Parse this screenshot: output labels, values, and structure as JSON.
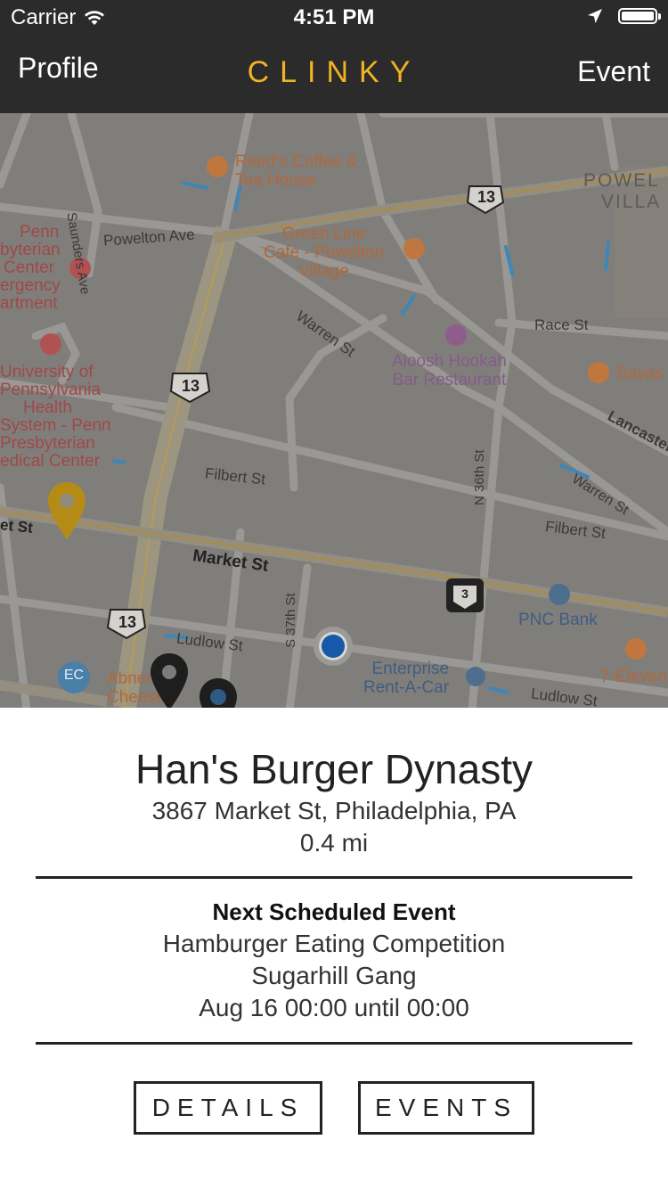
{
  "status_bar": {
    "carrier": "Carrier",
    "time": "4:51 PM",
    "icons": [
      "wifi-icon",
      "location-arrow-icon",
      "battery-icon"
    ]
  },
  "nav": {
    "left_label": "Profile",
    "title": "CLINKY",
    "right_label": "Event",
    "title_color": "#f0b323",
    "bar_color": "#2b2b2b"
  },
  "map": {
    "streets": [
      "Powelton Ave",
      "Warren St",
      "Race St",
      "Lancaster",
      "Filbert St",
      "Market St",
      "Ludlow St",
      "N 36th St",
      "S 37th St",
      "Saunders Ave",
      "Warren St",
      "Filbert St",
      "Ludlow St",
      "et St"
    ],
    "route_shields": [
      "13",
      "13",
      "13",
      "3"
    ],
    "places": [
      "Reed's Coffee &",
      "Tea House",
      "Green Line",
      "Cafe - Powelton",
      "Village",
      "Aloosh Hookah",
      "Bar Restaurant",
      "Savas",
      "PNC Bank",
      "7-Eleven",
      "Enterprise",
      "Rent-A-Car",
      "Abner's",
      "Cheesest",
      "Penn",
      "byterian",
      "Center",
      "ergency",
      "artment",
      "University of",
      "Pennsylvania",
      "Health",
      "System - Penn",
      "Presbyterian",
      "edical Center",
      "POWEL",
      "VILLA"
    ],
    "badge_ec": "EC",
    "pins": [
      "selected-pin-icon",
      "venue-pin-icon",
      "venue-pin-icon",
      "current-location-icon"
    ]
  },
  "venue": {
    "name": "Han's Burger Dynasty",
    "address": "3867 Market St, Philadelphia, PA",
    "distance": "0.4 mi"
  },
  "next_event": {
    "heading": "Next Scheduled Event",
    "title": "Hamburger Eating Competition",
    "performer": "Sugarhill Gang",
    "time": "Aug 16 00:00 until 00:00"
  },
  "buttons": {
    "details": "DETAILS",
    "events": "EVENTS"
  }
}
